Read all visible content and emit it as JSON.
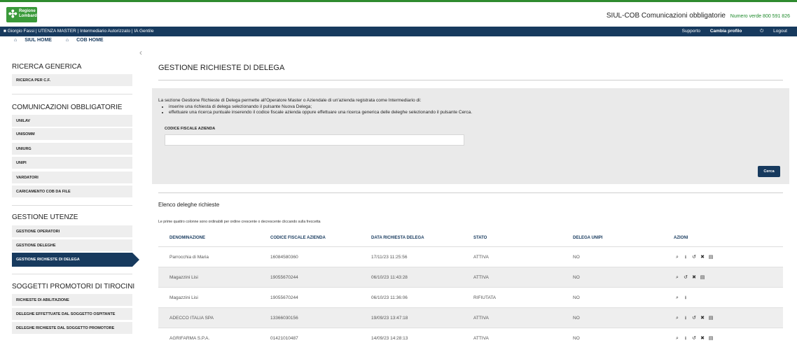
{
  "header": {
    "logo_line1": "Regione",
    "logo_line2": "Lombardia",
    "app_name": "SIUL-COB",
    "app_desc": "Comunicazioni obbligatorie",
    "green_number": "Numero verde 800 591 826",
    "user": "Giorgio Fassi | UTENZA MASTER | Intermediario Autorizzato | IA Gentile",
    "support": "Supporto",
    "change_profile": "Cambia profilo",
    "logout": "Logout",
    "siul_home": "SIUL HOME",
    "cob_home": "COB HOME"
  },
  "sidebar": {
    "ricerca_generica": "RICERCA GENERICA",
    "ricerca_cf": "RICERCA PER C.F.",
    "comunicazioni": "COMUNICAZIONI OBBLIGATORIE",
    "unilav": "UNILAV",
    "unisomm": "UNISOMM",
    "uniurg": "UNIURG",
    "unipi": "UNIPI",
    "vardatori": "VARDATORI",
    "caricamento": "CARICAMENTO COB DA FILE",
    "gestione_utenze": "GESTIONE UTENZE",
    "gestione_operatori": "GESTIONE OPERATORI",
    "gestione_deleghe": "GESTIONE DELEGHE",
    "gestione_richieste": "GESTIONE RICHIESTE DI DELEGA",
    "soggetti": "SOGGETTI PROMOTORI DI TIROCINI",
    "richieste_abilitazione": "RICHIESTE DI ABILITAZIONE",
    "deleghe_ospitante": "DELEGHE EFFETTUATE DAL SOGGETTO OSPITANTE",
    "deleghe_promotore": "DELEGHE RICHIESTE DAL SOGGETTO PROMOTORE"
  },
  "main": {
    "title": "GESTIONE RICHIESTE DI DELEGA",
    "intro": "La sezione Gestione Richieste di Delega permette all'Operatore Master o Aziendale di un'azienda registrata come Intermediario di:",
    "bullet1": "inserire una richiesta di delega selezionando il pulsante Nuova Delega;",
    "bullet2": "effettuare una ricerca puntuale inserendo il codice fiscale azienda oppure effettuare una ricerca generica delle deleghe selezionando il pulsante Cerca.",
    "field_label": "CODICE FISCALE AZIENDA",
    "field_value": "",
    "search_button": "Cerca",
    "list_title": "Elenco deleghe richieste",
    "hint": "Le prime quattro colonne sono ordinabili per ordine crescente o decrescente cliccando sulla freccetta"
  },
  "table": {
    "headers": {
      "denominazione": "DENOMINAZIONE",
      "codice": "CODICE FISCALE AZIENDA",
      "data": "DATA RICHIESTA DELEGA",
      "stato": "STATO",
      "delega_unipi": "DELEGA UNIPI",
      "azioni": "AZIONI"
    },
    "rows": [
      {
        "denominazione": "Parrocchia di Maria",
        "codice": "16084580360",
        "data": "17/11/23 11:25:56",
        "stato": "ATTIVA",
        "delega_unipi": "NO",
        "actions": [
          "search-icon",
          "download-icon",
          "rotate-icon",
          "close-icon",
          "calculator-icon"
        ]
      },
      {
        "denominazione": "Magazzini Lisi",
        "codice": "19055670244",
        "data": "06/10/23 11:43:28",
        "stato": "ATTIVA",
        "delega_unipi": "NO",
        "actions": [
          "search-icon",
          "rotate-icon",
          "close-icon",
          "calculator-icon"
        ]
      },
      {
        "denominazione": "Magazzini Lisi",
        "codice": "19055670244",
        "data": "06/10/23 11:36:06",
        "stato": "RIFIUTATA",
        "delega_unipi": "NO",
        "actions": [
          "search-icon",
          "download-icon"
        ]
      },
      {
        "denominazione": "ADECCO ITALIA SPA",
        "codice": "13366030156",
        "data": "19/09/23 13:47:18",
        "stato": "ATTIVA",
        "delega_unipi": "NO",
        "actions": [
          "search-icon",
          "download-icon",
          "rotate-icon",
          "close-icon",
          "calculator-icon"
        ]
      },
      {
        "denominazione": "AGRIFARMA S.P.A.",
        "codice": "01421010487",
        "data": "14/09/23 14:28:13",
        "stato": "ATTIVA",
        "delega_unipi": "NO",
        "actions": [
          "search-icon",
          "download-icon",
          "rotate-icon",
          "close-icon",
          "calculator-icon"
        ]
      }
    ]
  },
  "colors": {
    "primary": "#173a5e",
    "accent_green": "#2e8b2e",
    "panel": "#eaeaea"
  }
}
